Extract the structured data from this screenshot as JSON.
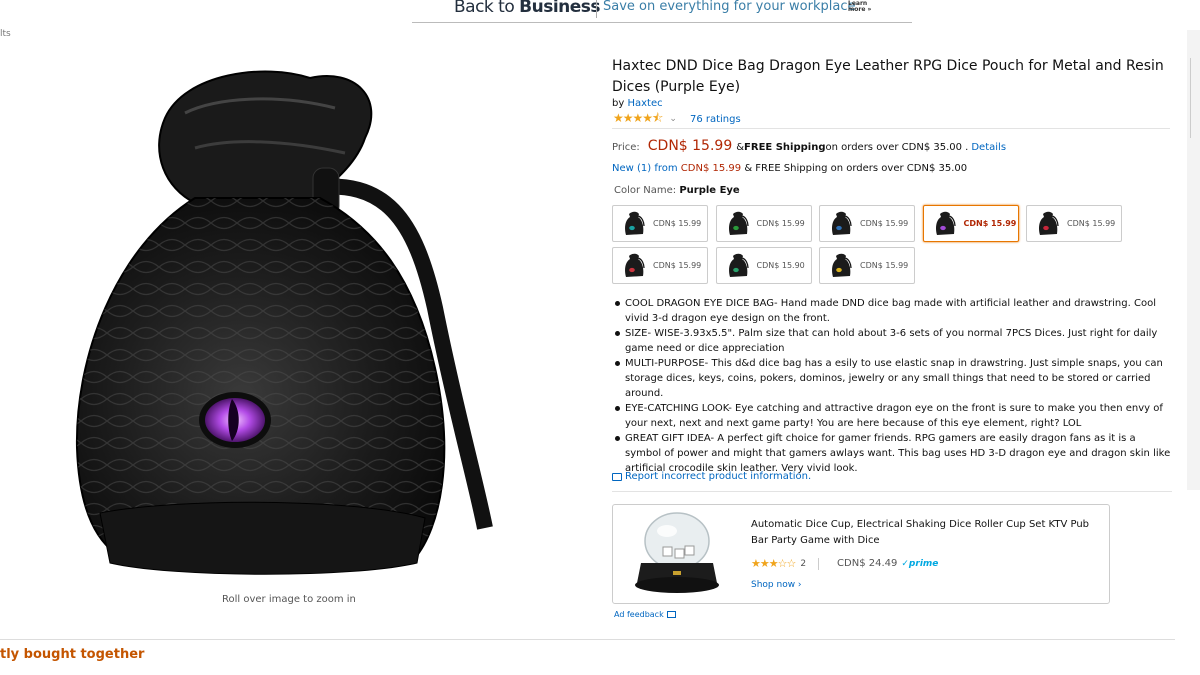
{
  "banner": {
    "title_back": "Back to ",
    "title_bold": "Business",
    "subtitle": "Save on everything for your workplace",
    "learn_more": "Learn more »"
  },
  "breadcrumb": "lts",
  "image": {
    "zoom_hint": "Roll over image to zoom in"
  },
  "product": {
    "title": "Haxtec DND Dice Bag Dragon Eye Leather RPG Dice Pouch for Metal and Resin Dices (Purple Eye)",
    "by_prefix": "by ",
    "brand": "Haxtec",
    "stars": "★★★★⯪",
    "ratings": "76 ratings",
    "price_label": "Price:",
    "price": "CDN$ 15.99",
    "shipping_prefix": "& ",
    "shipping_bold": "FREE Shipping",
    "shipping_rest": " on orders over CDN$ 35.00 .",
    "details_link": "Details",
    "new_link": "New (1) from ",
    "new_price": "CDN$ 15.99",
    "new_rest": " & FREE Shipping on orders over CDN$ 35.00",
    "color_label": "Color Name: ",
    "color_value": "Purple Eye"
  },
  "swatches": [
    {
      "price": "CDN$ 15.99",
      "eye": "#1aa3a3",
      "selected": false
    },
    {
      "price": "CDN$ 15.99",
      "eye": "#2a9a3a",
      "selected": false
    },
    {
      "price": "CDN$ 15.99",
      "eye": "#2d6fb5",
      "selected": false
    },
    {
      "price": "CDN$ 15.99",
      "eye": "#a24bd8",
      "selected": true
    },
    {
      "price": "CDN$ 15.99",
      "eye": "#c8263a",
      "selected": false
    },
    {
      "price": "CDN$ 15.99",
      "eye": "#c9343e",
      "selected": false
    },
    {
      "price": "CDN$ 15.90",
      "eye": "#28a06a",
      "selected": false
    },
    {
      "price": "CDN$ 15.99",
      "eye": "#d9b21f",
      "selected": false
    }
  ],
  "bullets": [
    "COOL DRAGON EYE DICE BAG- Hand made DND dice bag made with artificial leather and drawstring. Cool vivid 3-d dragon eye design on the front.",
    "SIZE- WISE-3.93x5.5\". Palm size that can hold about 3-6 sets of you normal 7PCS Dices. Just right for daily game need or dice appreciation",
    "MULTI-PURPOSE- This d&d dice bag has a esily to use elastic snap in drawstring. Just simple snaps, you can storage dices, keys, coins, pokers, dominos, jewelry or any small things that need to be stored or carried around.",
    "EYE-CATCHING LOOK- Eye catching and attractive dragon eye on the front is sure to make you then envy of your next, next and next game party! You are here because of this eye element, right? LOL",
    "GREAT GIFT IDEA- A perfect gift choice for gamer friends. RPG gamers are easily dragon fans as it is a symbol of power and might that gamers awlays want. This bag uses HD 3-D dragon eye and dragon skin like artificial crocodile skin leather. Very vivid look."
  ],
  "report_link": "Report incorrect product information.",
  "ad": {
    "title": "Automatic Dice Cup, Electrical Shaking Dice Roller Cup Set KTV Pub Bar Party Game with Dice",
    "stars": "★★★☆☆",
    "count": "2",
    "price": "CDN$ 24.49",
    "prime": "✓prime",
    "shop": "Shop now ›"
  },
  "ad_feedback": "Ad feedback",
  "frequently_bought": "tly bought together",
  "colors": {
    "link": "#0066c0",
    "price": "#b12704",
    "star": "#f0a41c",
    "selected_border": "#e77600",
    "section_heading": "#c45500",
    "eye_purple": "#a24bd8"
  }
}
